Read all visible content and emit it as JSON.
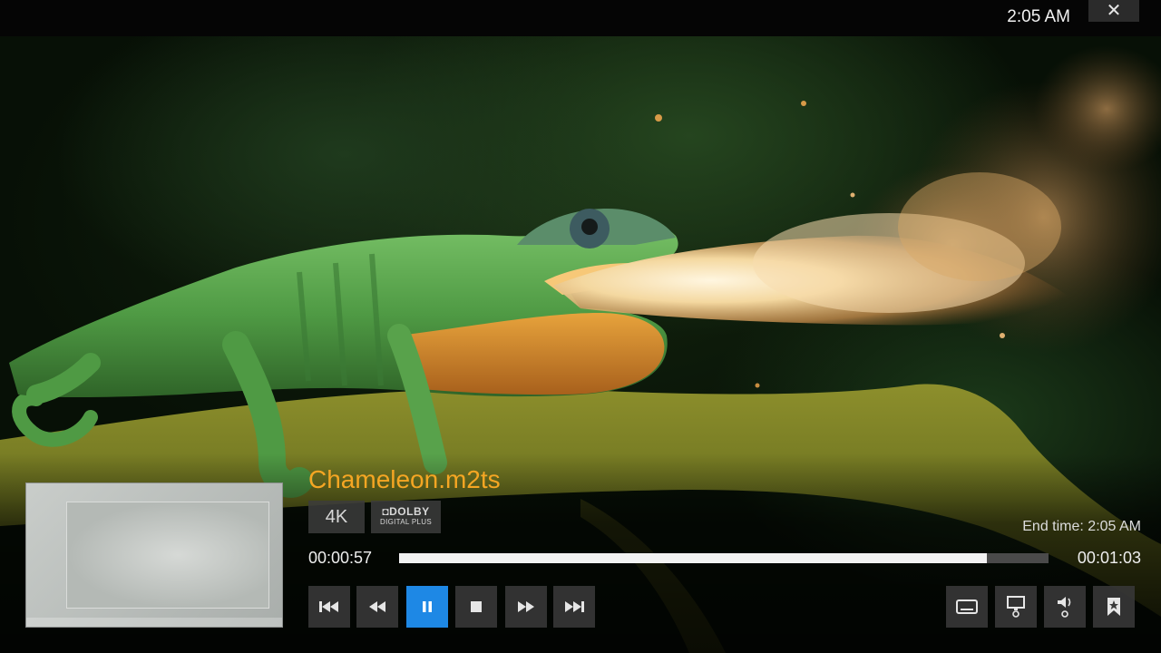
{
  "topbar": {
    "clock": "2:05 AM",
    "close_label": "✕"
  },
  "media": {
    "title": "Chameleon.m2ts",
    "badges": {
      "resolution": "4K",
      "audio_line1": "◘DOLBY",
      "audio_line2": "DIGITAL PLUS"
    },
    "end_time_label": "End time:",
    "end_time_value": "2:05 AM",
    "elapsed": "00:00:57",
    "total": "00:01:03",
    "progress_fraction": 0.905
  },
  "controls": {
    "transport": [
      "previous-icon",
      "rewind-icon",
      "pause-icon",
      "stop-icon",
      "fast-forward-icon",
      "next-icon"
    ],
    "options": [
      "subtitles-icon",
      "video-settings-icon",
      "audio-settings-icon",
      "bookmark-icon"
    ],
    "active": "pause-icon"
  },
  "colors": {
    "accent": "#1e88e5",
    "title": "#f5a623"
  }
}
